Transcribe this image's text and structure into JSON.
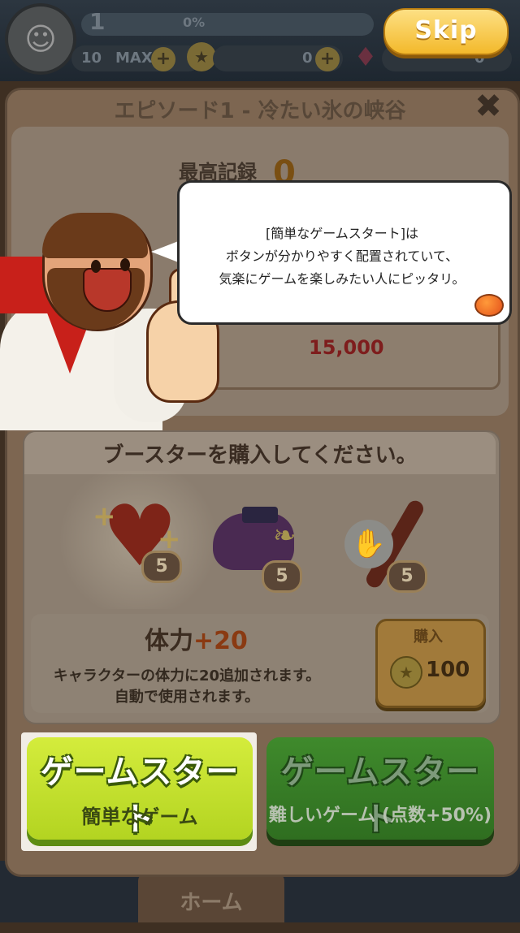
{
  "hud": {
    "level": "1",
    "xp_text": "0%",
    "lives_count": "10",
    "lives_max": "MAX",
    "coins": "0",
    "gems": "0"
  },
  "skip_label": "Skip",
  "popup": {
    "title": "エピソード1 - 冷たい氷の峡谷",
    "best_record_label": "最高記録",
    "best_record_value": "0",
    "target_score": "15,000"
  },
  "tutorial": {
    "lines": [
      "[簡単なゲームスタート]は",
      "ボタンが分かりやすく配置されていて、",
      "気楽にゲームを楽しみたい人にピッタリ。"
    ]
  },
  "booster": {
    "title": "ブースターを購入してください。",
    "items": [
      {
        "icon": "heart-icon",
        "count": "5"
      },
      {
        "icon": "boot-icon",
        "count": "5"
      },
      {
        "icon": "bat-icon",
        "count": "5"
      }
    ],
    "selected_name": "体力",
    "selected_bonus": "+20",
    "description_lines": [
      "キャラクターの体力に20追加されます。",
      "自動で使用されます。"
    ],
    "buy_label": "購入",
    "buy_price": "100"
  },
  "start_easy": {
    "title": "ゲームスタート",
    "subtitle": "簡単なゲーム"
  },
  "start_hard": {
    "title": "ゲームスタート",
    "subtitle": "難しいゲーム (点数+50%)"
  },
  "bottom_tab": "ホーム",
  "colors": {
    "easy_button": "#b8d82a",
    "hard_button": "#2f6e20",
    "skip_button": "#f6c53a",
    "target_score": "#7e1d1d"
  }
}
